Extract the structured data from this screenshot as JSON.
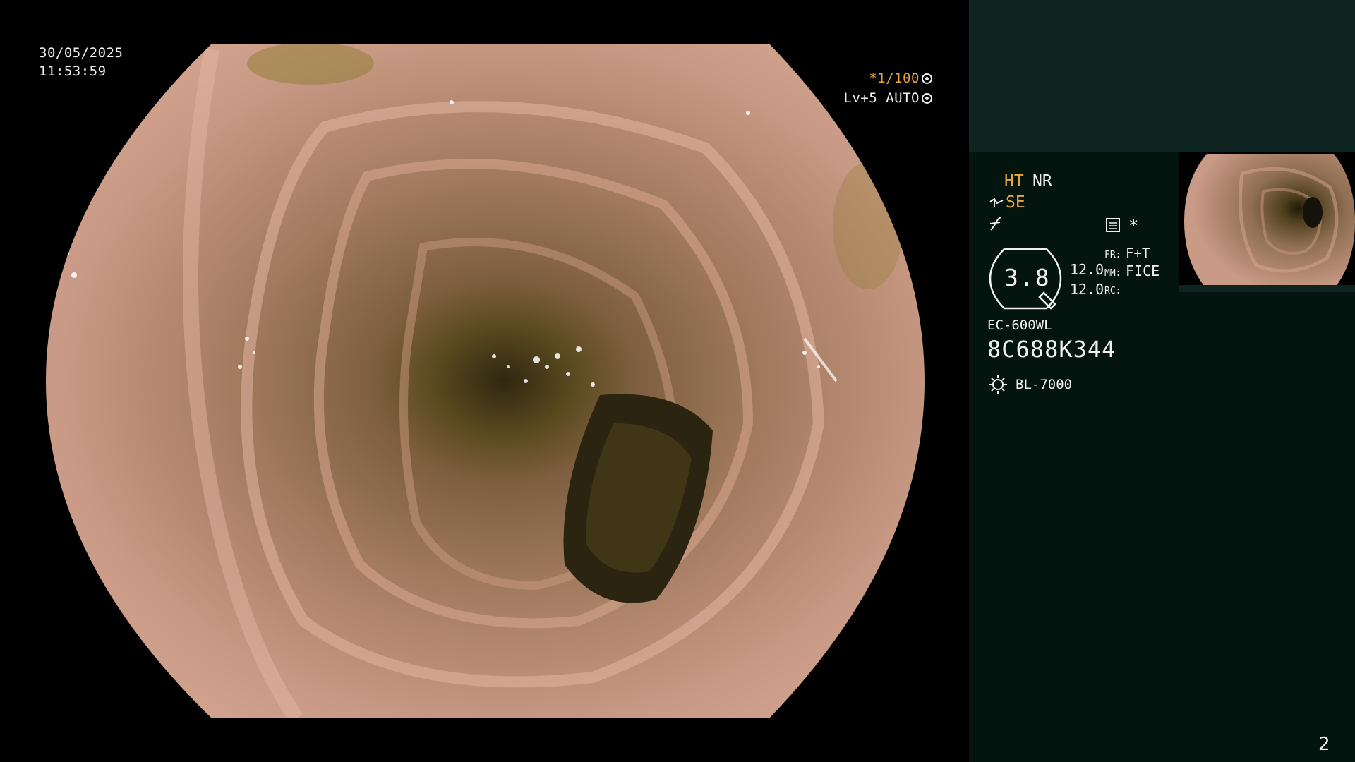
{
  "overlay": {
    "date": "30/05/2025",
    "time": "11:53:59",
    "shutter_prefix": "*",
    "shutter": "1/100",
    "level": "Lv+5",
    "exposure_mode": "AUTO"
  },
  "panel": {
    "ht_label": "HT",
    "nr_label": "NR",
    "se_label": "SE",
    "star": "*",
    "zoom_value": "3.8",
    "value_1": "12.0",
    "value_2": "12.0",
    "fr_label": "FR:",
    "fr_value": "F+T",
    "mm_label": "MM:",
    "mm_value": "FICE",
    "rc_label": "RC:",
    "scope_model": "EC-600WL",
    "scope_serial": "8C688K344",
    "light_source": "BL-7000",
    "page_number": "2"
  },
  "icons": [
    "settings-icon",
    "auto-exposure-icon",
    "structure-enhance-icon",
    "freeze-icon",
    "color-enhance-icon",
    "zoom-badge-icon",
    "lamp-icon"
  ],
  "colors": {
    "panel_background": "#04140f",
    "panel_top": "#0d2421",
    "amber_text": "#e8a83a",
    "osd_text": "#f2f2f2"
  }
}
